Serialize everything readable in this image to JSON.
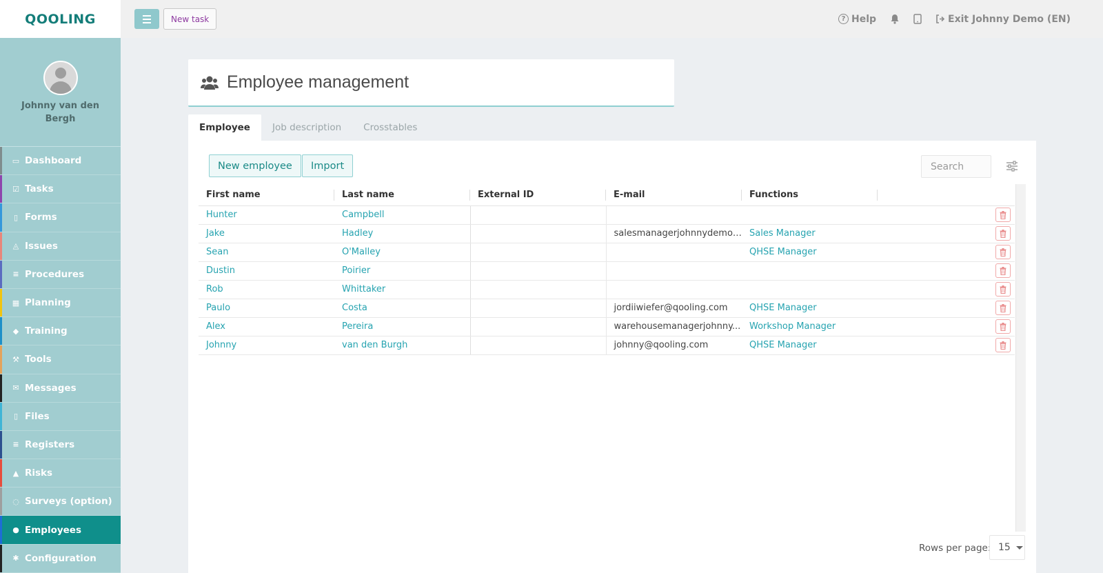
{
  "app": {
    "logo_text": "QOOLING"
  },
  "profile": {
    "name": "Johnny van den Bergh"
  },
  "sidebar": {
    "items": [
      {
        "label": "Dashboard",
        "icon": "monitor-icon",
        "color": "#7f8c8d"
      },
      {
        "label": "Tasks",
        "icon": "check-square-icon",
        "color": "#8e44ad"
      },
      {
        "label": "Forms",
        "icon": "file-icon",
        "color": "#3498db"
      },
      {
        "label": "Issues",
        "icon": "bell-icon",
        "color": "#e8867a"
      },
      {
        "label": "Procedures",
        "icon": "list-icon",
        "color": "#5b6bc0"
      },
      {
        "label": "Planning",
        "icon": "calendar-icon",
        "color": "#f1c40f"
      },
      {
        "label": "Training",
        "icon": "graduation-cap-icon",
        "color": "#1e90c8"
      },
      {
        "label": "Tools",
        "icon": "wrench-icon",
        "color": "#e3a35b"
      },
      {
        "label": "Messages",
        "icon": "envelope-icon",
        "color": "#222222"
      },
      {
        "label": "Files",
        "icon": "file-icon",
        "color": "#3fb5d6"
      },
      {
        "label": "Registers",
        "icon": "list-icon",
        "color": "#2c4f8f"
      },
      {
        "label": "Risks",
        "icon": "warning-icon",
        "color": "#e74c3c"
      },
      {
        "label": "Surveys (option)",
        "icon": "comment-icon",
        "color": "#9e9e9e"
      },
      {
        "label": "Employees",
        "icon": "users-icon",
        "color": "#1e6dd6"
      },
      {
        "label": "Configuration",
        "icon": "gear-icon",
        "color": "#222222"
      }
    ],
    "active": "Employees"
  },
  "topbar": {
    "new_task_label": "New task",
    "help_label": "Help",
    "exit_label": "Exit Johnny Demo (EN)"
  },
  "page": {
    "title": "Employee management",
    "tabs": [
      {
        "label": "Employee",
        "active": true
      },
      {
        "label": "Job description",
        "active": false
      },
      {
        "label": "Crosstables",
        "active": false
      }
    ]
  },
  "toolbar": {
    "new_employee_label": "New employee",
    "import_label": "Import",
    "search_placeholder": "Search"
  },
  "table": {
    "columns": [
      "First name",
      "Last name",
      "External ID",
      "E-mail",
      "Functions"
    ],
    "rows": [
      {
        "first": "Hunter",
        "last": "Campbell",
        "external_id": "",
        "email": "",
        "function": ""
      },
      {
        "first": "Jake",
        "last": "Hadley",
        "external_id": "",
        "email": "salesmanagerjohnnydemo(...",
        "function": "Sales Manager"
      },
      {
        "first": "Sean",
        "last": "O'Malley",
        "external_id": "",
        "email": "",
        "function": "QHSE Manager"
      },
      {
        "first": "Dustin",
        "last": "Poirier",
        "external_id": "",
        "email": "",
        "function": ""
      },
      {
        "first": "Rob",
        "last": "Whittaker",
        "external_id": "",
        "email": "",
        "function": ""
      },
      {
        "first": "Paulo",
        "last": "Costa",
        "external_id": "",
        "email": "jordiiwiefer@qooling.com",
        "function": "QHSE Manager"
      },
      {
        "first": "Alex",
        "last": "Pereira",
        "external_id": "",
        "email": "warehousemanagerjohnny...",
        "function": "Workshop Manager"
      },
      {
        "first": "Johnny",
        "last": "van den Burgh",
        "external_id": "",
        "email": "johnny@qooling.com",
        "function": "QHSE Manager"
      }
    ]
  },
  "pagination": {
    "rows_per_page_label": "Rows per page:",
    "rows_per_page_value": "15"
  }
}
